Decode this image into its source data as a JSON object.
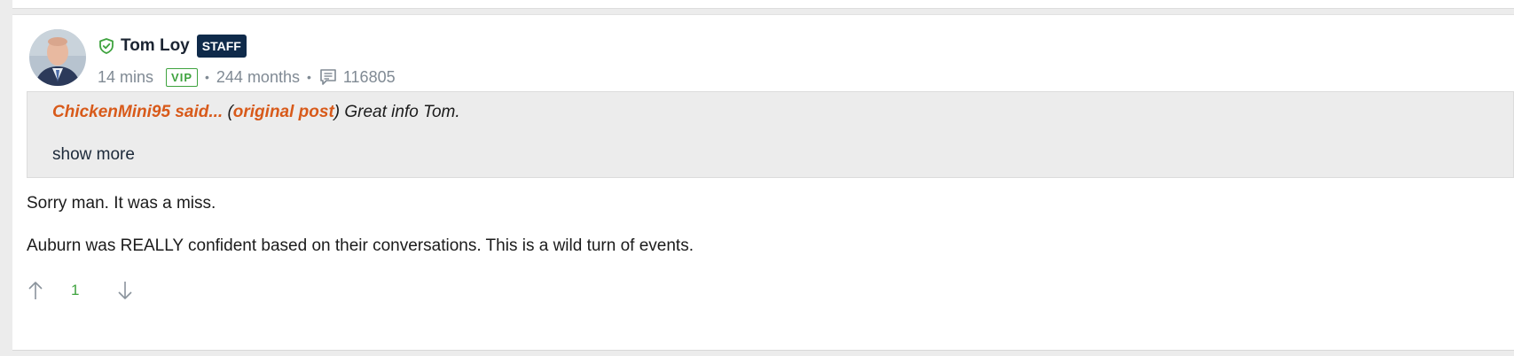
{
  "author": {
    "name": "Tom Loy",
    "badge": "STAFF"
  },
  "meta": {
    "time": "14 mins",
    "vip": "VIP",
    "tenure": "244 months",
    "post_count": "116805"
  },
  "quote": {
    "user": "ChickenMini95 said...",
    "open_paren": " (",
    "link": "original post",
    "close_text": ") Great info Tom.",
    "show_more": "show more"
  },
  "body": {
    "paragraphs": [
      "Sorry man. It was a miss.",
      "Auburn was REALLY confident based on their conversations. This is a wild turn of events."
    ]
  },
  "votes": {
    "count": "1"
  },
  "colors": {
    "accent_orange": "#d85a1a",
    "vip_green": "#3fa33f",
    "staff_navy": "#0f2a4a"
  },
  "icons": {
    "verified": "shield-check-icon",
    "posts": "message-icon",
    "upvote": "arrow-up-icon",
    "downvote": "arrow-down-icon"
  }
}
